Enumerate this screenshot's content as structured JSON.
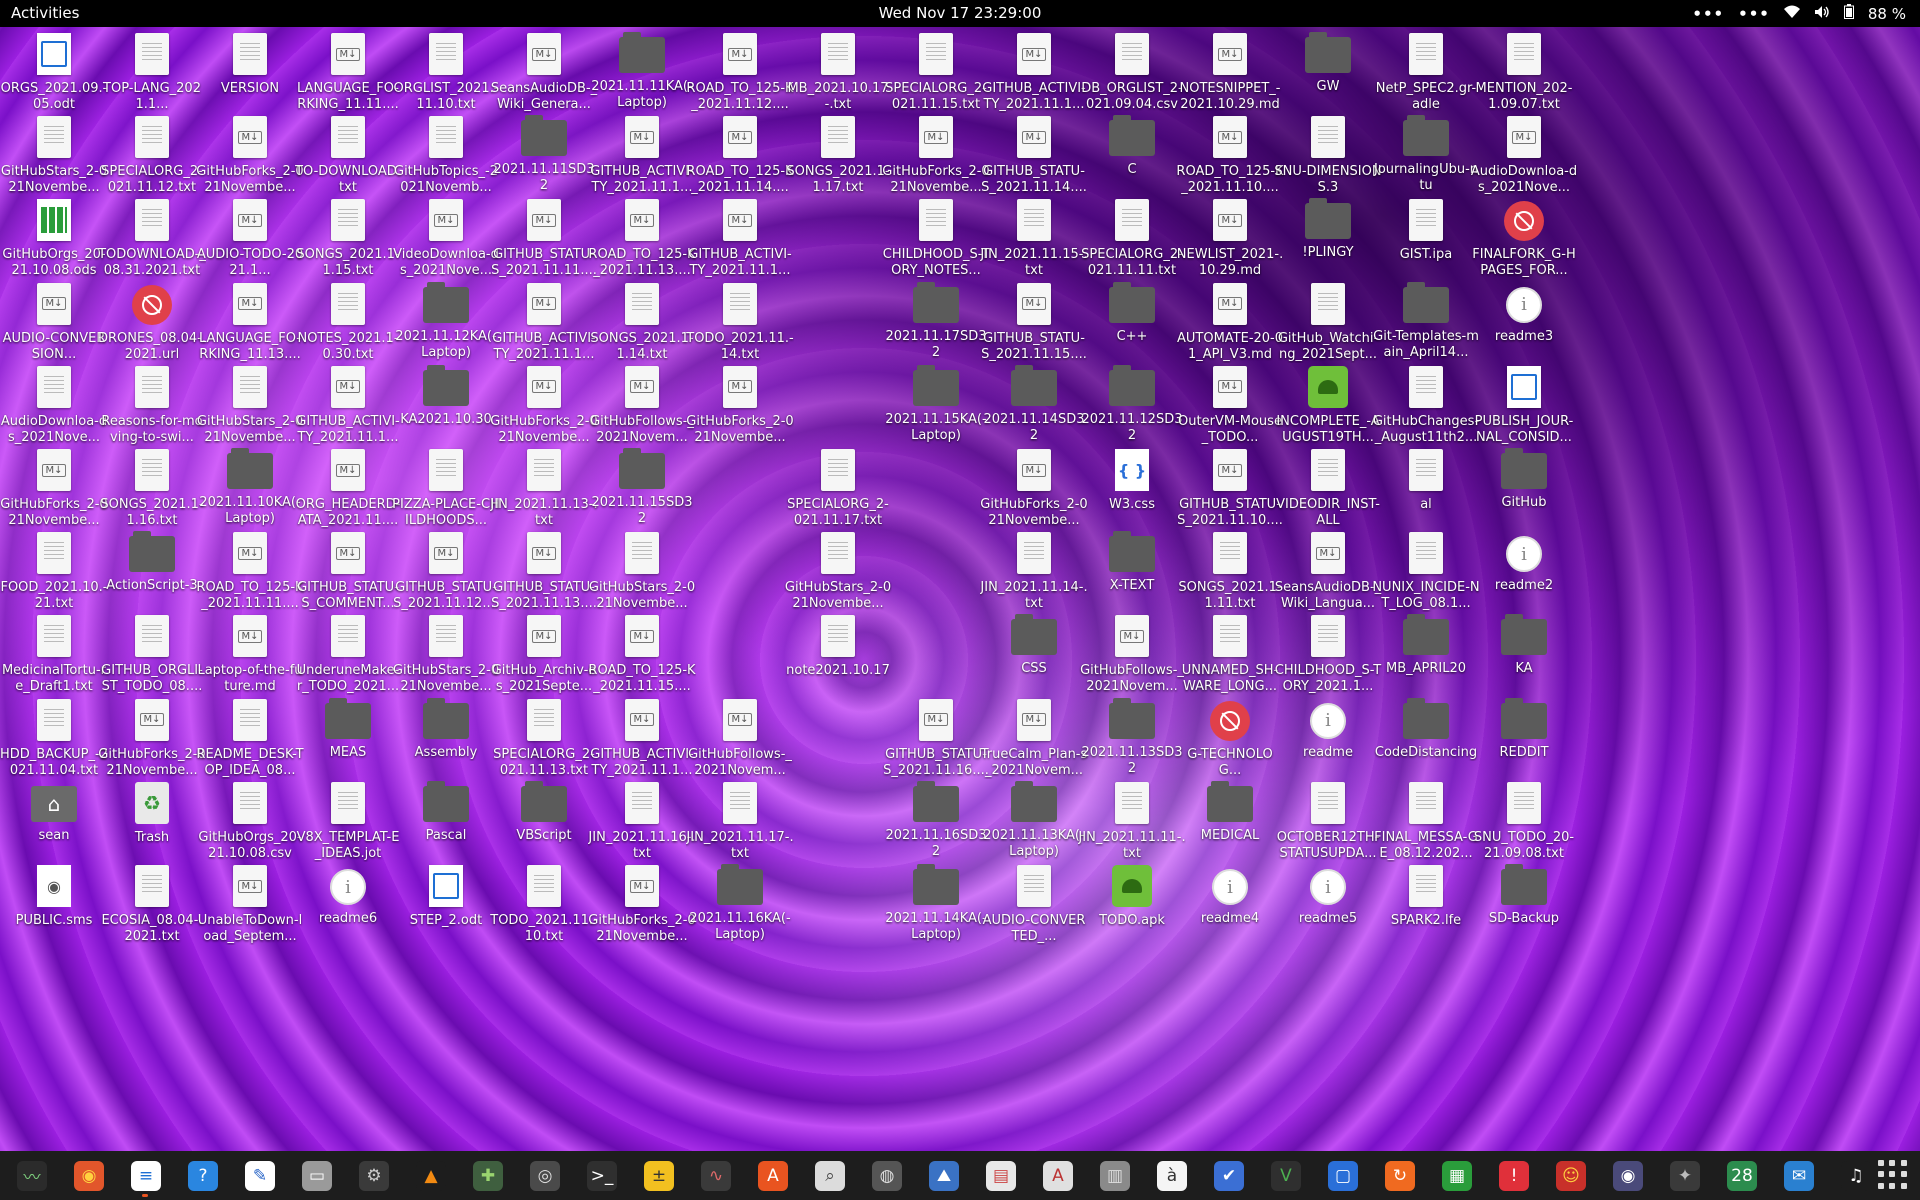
{
  "topbar": {
    "activities": "Activities",
    "clock": "Wed Nov 17  23:29:00",
    "tray_menu1": "•••",
    "tray_menu2": "•••",
    "battery": "88 %"
  },
  "desktop": {
    "icons": [
      {
        "label": "ORGS_2021.09.-05.odt",
        "type": "odt"
      },
      {
        "label": "TOP-LANG_2021.1...",
        "type": "file"
      },
      {
        "label": "VERSION",
        "type": "file"
      },
      {
        "label": "LANGUAGE_FO-RKING_11.11....",
        "type": "md"
      },
      {
        "label": "ORGLIST_2021.-11.10.txt",
        "type": "file"
      },
      {
        "label": "SeansAudioDB-_Wiki_Genera...",
        "type": "md"
      },
      {
        "label": "2021.11.11KA(-Laptop)",
        "type": "folder"
      },
      {
        "label": "ROAD_TO_125-K_2021.11.12....",
        "type": "md"
      },
      {
        "label": "MB_2021.10.17-.txt",
        "type": "file"
      },
      {
        "label": "SPECIALORG_2-021.11.15.txt",
        "type": "file"
      },
      {
        "label": "GITHUB_ACTIVI-TY_2021.11.1...",
        "type": "md"
      },
      {
        "label": "DB_ORGLIST_2-021.09.04.csv",
        "type": "file"
      },
      {
        "label": "NOTESNIPPET_-2021.10.29.md",
        "type": "md"
      },
      {
        "label": "GW",
        "type": "folder"
      },
      {
        "label": "NetP_SPEC2.gr-adle",
        "type": "file"
      },
      {
        "label": "MENTION_202-1.09.07.txt",
        "type": "file"
      },
      {
        "label": "GitHubStars_2-021Novembe...",
        "type": "file"
      },
      {
        "label": "SPECIALORG_2-021.11.12.txt",
        "type": "file"
      },
      {
        "label": "GitHubForks_2-021Novembe...",
        "type": "md"
      },
      {
        "label": "TO-DOWNLOAD.txt",
        "type": "file"
      },
      {
        "label": "GitHubTopics_-2021Novemb...",
        "type": "file"
      },
      {
        "label": "2021.11.11SD32",
        "type": "folder"
      },
      {
        "label": "GITHUB_ACTIVI-TY_2021.11.1...",
        "type": "md"
      },
      {
        "label": "ROAD_TO_125-K_2021.11.14....",
        "type": "md"
      },
      {
        "label": "SONGS_2021.1-1.17.txt",
        "type": "file"
      },
      {
        "label": "GitHubForks_2-021Novembe...",
        "type": "md"
      },
      {
        "label": "GITHUB_STATU-S_2021.11.14....",
        "type": "md"
      },
      {
        "label": "C",
        "type": "folder"
      },
      {
        "label": "ROAD_TO_125-K_2021.11.10....",
        "type": "md"
      },
      {
        "label": "SNU-DIMENSIONS.3",
        "type": "file"
      },
      {
        "label": "JournalingUbu-ntu",
        "type": "folder"
      },
      {
        "label": "AudioDownloa-ds_2021Nove...",
        "type": "md"
      },
      {
        "label": "GitHubOrgs_20-21.10.08.ods",
        "type": "ods"
      },
      {
        "label": "TODOWNLOAD-_08.31.2021.txt",
        "type": "file"
      },
      {
        "label": "AUDIO-TODO-2021.1...",
        "type": "md"
      },
      {
        "label": "SONGS_2021.1-1.15.txt",
        "type": "file"
      },
      {
        "label": "VideoDownloa-ds_2021Nove...",
        "type": "md"
      },
      {
        "label": "GITHUB_STATU-S_2021.11.11....",
        "type": "md"
      },
      {
        "label": "ROAD_TO_125-K_2021.11.13....",
        "type": "md"
      },
      {
        "label": "GITHUB_ACTIVI-TY_2021.11.1...",
        "type": "md"
      },
      {
        "label": "",
        "type": "none"
      },
      {
        "label": "CHILDHOOD_S-TORY_NOTES...",
        "type": "file"
      },
      {
        "label": "JIN_2021.11.15-.txt",
        "type": "file"
      },
      {
        "label": "SPECIALORG_2-021.11.11.txt",
        "type": "file"
      },
      {
        "label": "NEWLIST_2021-.10.29.md",
        "type": "md"
      },
      {
        "label": "!PLINGY",
        "type": "folder"
      },
      {
        "label": "GIST.ipa",
        "type": "file"
      },
      {
        "label": "FINALFORK_G-HPAGES_FOR...",
        "type": "blocked"
      },
      {
        "label": "AUDIO-CONVERSION...",
        "type": "md"
      },
      {
        "label": "DRONES_08.04-.2021.url",
        "type": "blocked"
      },
      {
        "label": "LANGUAGE_FO-RKING_11.13....",
        "type": "md"
      },
      {
        "label": "NOTES_2021.1-0.30.txt",
        "type": "file"
      },
      {
        "label": "2021.11.12KA(-Laptop)",
        "type": "folder"
      },
      {
        "label": "GITHUB_ACTIVI-TY_2021.11.1...",
        "type": "md"
      },
      {
        "label": "SONGS_2021.1-1.14.txt",
        "type": "file"
      },
      {
        "label": "TODO_2021.11.-14.txt",
        "type": "file"
      },
      {
        "label": "",
        "type": "none"
      },
      {
        "label": "2021.11.17SD32",
        "type": "folder"
      },
      {
        "label": "GITHUB_STATU-S_2021.11.15....",
        "type": "md"
      },
      {
        "label": "C++",
        "type": "folder"
      },
      {
        "label": "AUTOMATE-20-01_API_V3.md",
        "type": "md"
      },
      {
        "label": "GitHub_Watchi-ng_2021Sept...",
        "type": "file"
      },
      {
        "label": "Git-Templates-main_April14...",
        "type": "folder"
      },
      {
        "label": "readme3",
        "type": "info"
      },
      {
        "label": "AudioDownloa-ds_2021Nove...",
        "type": "file"
      },
      {
        "label": "Reasons-for-moving-to-swi...",
        "type": "file"
      },
      {
        "label": "GitHubStars_2-021Novembe...",
        "type": "file"
      },
      {
        "label": "GITHUB_ACTIVI-TY_2021.11.1...",
        "type": "md"
      },
      {
        "label": "KA2021.10.30",
        "type": "folder"
      },
      {
        "label": "GitHubForks_2-021Novembe...",
        "type": "md"
      },
      {
        "label": "GitHubFollows-_2021Novem...",
        "type": "md"
      },
      {
        "label": "GitHubForks_2-021Novembe...",
        "type": "md"
      },
      {
        "label": "",
        "type": "none"
      },
      {
        "label": "2021.11.15KA(-Laptop)",
        "type": "folder"
      },
      {
        "label": "2021.11.14SD32",
        "type": "folder"
      },
      {
        "label": "2021.11.12SD32",
        "type": "folder"
      },
      {
        "label": "OuterVM-Mouse_TODO...",
        "type": "md"
      },
      {
        "label": "INCOMPLETE_-AUGUST19TH...",
        "type": "apk"
      },
      {
        "label": "GitHubChanges-_August11th2...",
        "type": "file"
      },
      {
        "label": "PUBLISH_JOUR-NAL_CONSID...",
        "type": "odt"
      },
      {
        "label": "GitHubForks_2-021Novembe...",
        "type": "md"
      },
      {
        "label": "SONGS_2021.1-1.16.txt",
        "type": "file"
      },
      {
        "label": "2021.11.10KA(-Laptop)",
        "type": "folder"
      },
      {
        "label": "ORG_HEADERD-ATA_2021.11....",
        "type": "md"
      },
      {
        "label": "PIZZA-PLACE-CHILDHOODS...",
        "type": "file"
      },
      {
        "label": "JIN_2021.11.13-.txt",
        "type": "file"
      },
      {
        "label": "2021.11.15SD32",
        "type": "folder"
      },
      {
        "label": "",
        "type": "none"
      },
      {
        "label": "SPECIALORG_2-021.11.17.txt",
        "type": "file"
      },
      {
        "label": "",
        "type": "none"
      },
      {
        "label": "GitHubForks_2-021Novembe...",
        "type": "md"
      },
      {
        "label": "W3.css",
        "type": "css3"
      },
      {
        "label": "GITHUB_STATU-S_2021.11.10....",
        "type": "md"
      },
      {
        "label": "VIDEODIR_INST-ALL",
        "type": "file"
      },
      {
        "label": "al",
        "type": "file"
      },
      {
        "label": "GitHub",
        "type": "folder"
      },
      {
        "label": "FOOD_2021.10.-21.txt",
        "type": "file"
      },
      {
        "label": "ActionScript-3",
        "type": "folder"
      },
      {
        "label": "ROAD_TO_125-K_2021.11.11....",
        "type": "md"
      },
      {
        "label": "GITHUB_STATU-S_COMMENT...",
        "type": "md"
      },
      {
        "label": "GITHUB_STATU-S_2021.11.12....",
        "type": "md"
      },
      {
        "label": "GITHUB_STATU-S_2021.11.13....",
        "type": "md"
      },
      {
        "label": "GitHubStars_2-021Novembe...",
        "type": "file"
      },
      {
        "label": "",
        "type": "none"
      },
      {
        "label": "GitHubStars_2-021Novembe...",
        "type": "file"
      },
      {
        "label": "",
        "type": "none"
      },
      {
        "label": "JIN_2021.11.14-.txt",
        "type": "file"
      },
      {
        "label": "X-TEXT",
        "type": "folder"
      },
      {
        "label": "SONGS_2021.1-1.11.txt",
        "type": "file"
      },
      {
        "label": "SeansAudioDB-_Wiki_Langua...",
        "type": "md"
      },
      {
        "label": "NUNIX_INCIDE-NT_LOG_08.1...",
        "type": "file"
      },
      {
        "label": "readme2",
        "type": "info"
      },
      {
        "label": "MedicinalTortu-re_Draft1.txt",
        "type": "file"
      },
      {
        "label": "GITHUB_ORGLI-ST_TODO_08....",
        "type": "file"
      },
      {
        "label": "Laptop-of-the-future.md",
        "type": "md"
      },
      {
        "label": "UnderuneMake-r_TODO_2021...",
        "type": "file"
      },
      {
        "label": "GitHubStars_2-021Novembe...",
        "type": "file"
      },
      {
        "label": "GitHub_Archiv-es_2021Septe...",
        "type": "md"
      },
      {
        "label": "ROAD_TO_125-K_2021.11.15....",
        "type": "md"
      },
      {
        "label": "",
        "type": "none"
      },
      {
        "label": "note2021.10.17",
        "type": "file"
      },
      {
        "label": "",
        "type": "none"
      },
      {
        "label": "CSS",
        "type": "folder"
      },
      {
        "label": "GitHubFollows-_2021Novem...",
        "type": "md"
      },
      {
        "label": "UNNAMED_SH-WARE_LONG...",
        "type": "file"
      },
      {
        "label": "CHILDHOOD_S-TORY_2021.1...",
        "type": "file"
      },
      {
        "label": "MB_APRIL20",
        "type": "folder"
      },
      {
        "label": "KA",
        "type": "folder"
      },
      {
        "label": "HDD_BACKUP_-2021.11.04.txt",
        "type": "file"
      },
      {
        "label": "GitHubForks_2-021Novembe...",
        "type": "md"
      },
      {
        "label": "README_DESK-TOP_IDEA_08...",
        "type": "file"
      },
      {
        "label": "MEAS",
        "type": "folder"
      },
      {
        "label": "Assembly",
        "type": "folder"
      },
      {
        "label": "SPECIALORG_2-021.11.13.txt",
        "type": "file"
      },
      {
        "label": "GITHUB_ACTIVI-TY_2021.11.1...",
        "type": "md"
      },
      {
        "label": "GitHubFollows-_2021Novem...",
        "type": "md"
      },
      {
        "label": "",
        "type": "none"
      },
      {
        "label": "GITHUB_STATU-S_2021.11.16....",
        "type": "md"
      },
      {
        "label": "TrueCalm_Plan-s_2021Novem...",
        "type": "md"
      },
      {
        "label": "2021.11.13SD32",
        "type": "folder"
      },
      {
        "label": "G-TECHNOLOG...",
        "type": "blocked"
      },
      {
        "label": "readme",
        "type": "info"
      },
      {
        "label": "CodeDistancing",
        "type": "folder"
      },
      {
        "label": "REDDIT",
        "type": "folder"
      },
      {
        "label": "sean",
        "type": "home"
      },
      {
        "label": "Trash",
        "type": "trash"
      },
      {
        "label": "GitHubOrgs_20-21.10.08.csv",
        "type": "file"
      },
      {
        "label": "V8X_TEMPLAT-E_IDEAS.jot",
        "type": "file"
      },
      {
        "label": "Pascal",
        "type": "folder"
      },
      {
        "label": "VBScript",
        "type": "folder"
      },
      {
        "label": "JIN_2021.11.16-.txt",
        "type": "file"
      },
      {
        "label": "JIN_2021.11.17-.txt",
        "type": "file"
      },
      {
        "label": "",
        "type": "none"
      },
      {
        "label": "2021.11.16SD32",
        "type": "folder"
      },
      {
        "label": "2021.11.13KA(-Laptop)",
        "type": "folder"
      },
      {
        "label": "JIN_2021.11.11-.txt",
        "type": "file"
      },
      {
        "label": "MEDICAL",
        "type": "folder"
      },
      {
        "label": "OCTOBER12TH-STATUSUPDA...",
        "type": "file"
      },
      {
        "label": "FINAL_MESSA-GE_08.12.202...",
        "type": "file"
      },
      {
        "label": "SNU_TODO_20-21.09.08.txt",
        "type": "file"
      },
      {
        "label": "PUBLIC.sms",
        "type": "game"
      },
      {
        "label": "ECOSIA_08.04-.2021.txt",
        "type": "file"
      },
      {
        "label": "UnableToDown-load_Septem...",
        "type": "md"
      },
      {
        "label": "readme6",
        "type": "info"
      },
      {
        "label": "STEP_2.odt",
        "type": "odt"
      },
      {
        "label": "TODO_2021.11.-10.txt",
        "type": "file"
      },
      {
        "label": "GitHubForks_2-021Novembe...",
        "type": "md"
      },
      {
        "label": "2021.11.16KA(-Laptop)",
        "type": "folder"
      },
      {
        "label": "",
        "type": "none"
      },
      {
        "label": "2021.11.14KA(-Laptop)",
        "type": "folder"
      },
      {
        "label": "AUDIO-CONVERTED_...",
        "type": "file"
      },
      {
        "label": "TODO.apk",
        "type": "apk"
      },
      {
        "label": "readme4",
        "type": "info"
      },
      {
        "label": "readme5",
        "type": "info"
      },
      {
        "label": "SPARK2.lfe",
        "type": "file"
      },
      {
        "label": "SD-Backup",
        "type": "folder"
      }
    ]
  },
  "dock": {
    "apps": [
      {
        "name": "system-monitor-icon",
        "glyph": "〰",
        "bg": "#2b2b2b",
        "color": "#7fd37f"
      },
      {
        "name": "firefox-icon",
        "glyph": "◉",
        "bg": "#e2562b",
        "color": "#ffd23f"
      },
      {
        "name": "writer-icon",
        "glyph": "≡",
        "bg": "#ffffff",
        "color": "#1e6fd4",
        "running": true
      },
      {
        "name": "help-icon",
        "glyph": "?",
        "bg": "#2a86e0",
        "color": "#ffffff"
      },
      {
        "name": "text-editor-icon",
        "glyph": "✎",
        "bg": "#ffffff",
        "color": "#2a66c8"
      },
      {
        "name": "files-icon",
        "glyph": "▭",
        "bg": "#9a9a9a",
        "color": "#ffffff"
      },
      {
        "name": "settings-icon",
        "glyph": "⚙",
        "bg": "#3a3a3a",
        "color": "#cccccc"
      },
      {
        "name": "vlc-icon",
        "glyph": "▲",
        "bg": "#1d1d1d",
        "color": "#f28a12"
      },
      {
        "name": "puzzle-icon",
        "glyph": "✚",
        "bg": "#3f5f3f",
        "color": "#9ad46f"
      },
      {
        "name": "software-properties-icon",
        "glyph": "◎",
        "bg": "#4a4a4a",
        "color": "#dddddd"
      },
      {
        "name": "terminal-icon",
        "glyph": ">_",
        "bg": "#2f2f2f",
        "color": "#ffffff"
      },
      {
        "name": "calculator-icon",
        "glyph": "±",
        "bg": "#f2c020",
        "color": "#333333"
      },
      {
        "name": "pulse-icon",
        "glyph": "∿",
        "bg": "#3a3a3a",
        "color": "#e06a6a"
      },
      {
        "name": "app-store-icon",
        "glyph": "A",
        "bg": "#e95420",
        "color": "#ffffff"
      },
      {
        "name": "image-viewer-icon",
        "glyph": "⌕",
        "bg": "#dcdcdc",
        "color": "#444444"
      },
      {
        "name": "disk-icon",
        "glyph": "◍",
        "bg": "#555555",
        "color": "#dddddd"
      },
      {
        "name": "photos-icon",
        "glyph": "⛰",
        "bg": "#3a72c4",
        "color": "#ffffff"
      },
      {
        "name": "document-scanner-icon",
        "glyph": "▤",
        "bg": "#e8e8e8",
        "color": "#cc4444"
      },
      {
        "name": "font-viewer-icon",
        "glyph": "A",
        "bg": "#e0e0e0",
        "color": "#bb3333"
      },
      {
        "name": "archive-icon",
        "glyph": "▥",
        "bg": "#8a8a8a",
        "color": "#dddddd"
      },
      {
        "name": "character-map-icon",
        "glyph": "à",
        "bg": "#f5f5f5",
        "color": "#333333"
      },
      {
        "name": "todo-icon",
        "glyph": "✔",
        "bg": "#3b6fd4",
        "color": "#ffffff"
      },
      {
        "name": "vim-icon",
        "glyph": "V",
        "bg": "#2f2f2f",
        "color": "#4caf50"
      },
      {
        "name": "screen-icon",
        "glyph": "▢",
        "bg": "#2a6fd8",
        "color": "#ffffff"
      },
      {
        "name": "backup-icon",
        "glyph": "↻",
        "bg": "#f06a20",
        "color": "#ffffff"
      },
      {
        "name": "spreadsheet-icon",
        "glyph": "▦",
        "bg": "#2a9d3b",
        "color": "#ffffff"
      },
      {
        "name": "alert-icon",
        "glyph": "!",
        "bg": "#e0303a",
        "color": "#ffffff"
      },
      {
        "name": "mario-icon",
        "glyph": "☺",
        "bg": "#c8302a",
        "color": "#ffd23f"
      },
      {
        "name": "webcam-icon",
        "glyph": "◉",
        "bg": "#4a4a7a",
        "color": "#ffffff"
      },
      {
        "name": "gimp-icon",
        "glyph": "✦",
        "bg": "#3a3a3a",
        "color": "#bbbbbb"
      },
      {
        "name": "calendar-icon",
        "glyph": "28",
        "bg": "#2c8c4e",
        "color": "#ffffff"
      },
      {
        "name": "chat-icon",
        "glyph": "✉",
        "bg": "#2a80d0",
        "color": "#ffffff"
      },
      {
        "name": "music-icon",
        "glyph": "♫",
        "bg": "#1d1d1d",
        "color": "#ffffff"
      }
    ]
  }
}
